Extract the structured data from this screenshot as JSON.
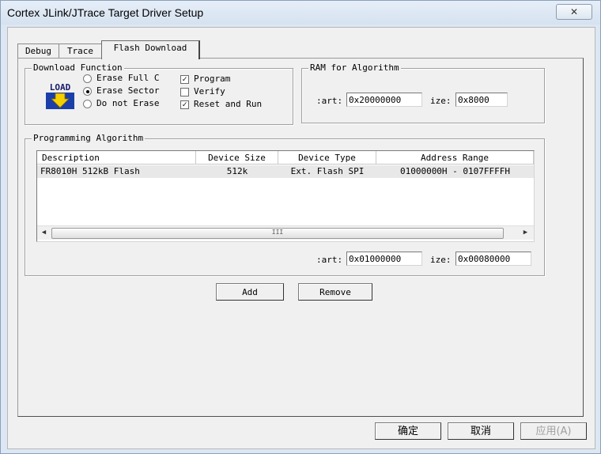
{
  "window": {
    "title": "Cortex JLink/JTrace Target Driver Setup",
    "close_glyph": "✕"
  },
  "tabs": [
    {
      "label": "Debug"
    },
    {
      "label": "Trace"
    },
    {
      "label": "Flash Download"
    }
  ],
  "download_function": {
    "title": "Download Function",
    "icon_label": "LOAD",
    "radios": [
      {
        "label": "Erase Full C",
        "checked": false
      },
      {
        "label": "Erase Sector",
        "checked": true
      },
      {
        "label": "Do not Erase",
        "checked": false
      }
    ],
    "checks": [
      {
        "label": "Program",
        "checked": true
      },
      {
        "label": "Verify",
        "checked": false
      },
      {
        "label": "Reset and Run",
        "checked": true
      }
    ]
  },
  "ram_for_algorithm": {
    "title": "RAM for Algorithm",
    "start_label": ":art:",
    "start_value": "0x20000000",
    "size_label": "ize:",
    "size_value": "0x8000"
  },
  "programming_algorithm": {
    "title": "Programming Algorithm",
    "columns": [
      "Description",
      "Device Size",
      "Device Type",
      "Address Range"
    ],
    "rows": [
      [
        "FR8010H 512kB Flash",
        "512k",
        "Ext. Flash SPI",
        "01000000H - 0107FFFFH"
      ]
    ],
    "scroll_grip": "III",
    "start_label": ":art:",
    "start_value": "0x01000000",
    "size_label": "ize:",
    "size_value": "0x00080000"
  },
  "buttons": {
    "add": "Add",
    "remove": "Remove",
    "ok": "确定",
    "cancel": "取消",
    "apply": "应用(A)"
  }
}
